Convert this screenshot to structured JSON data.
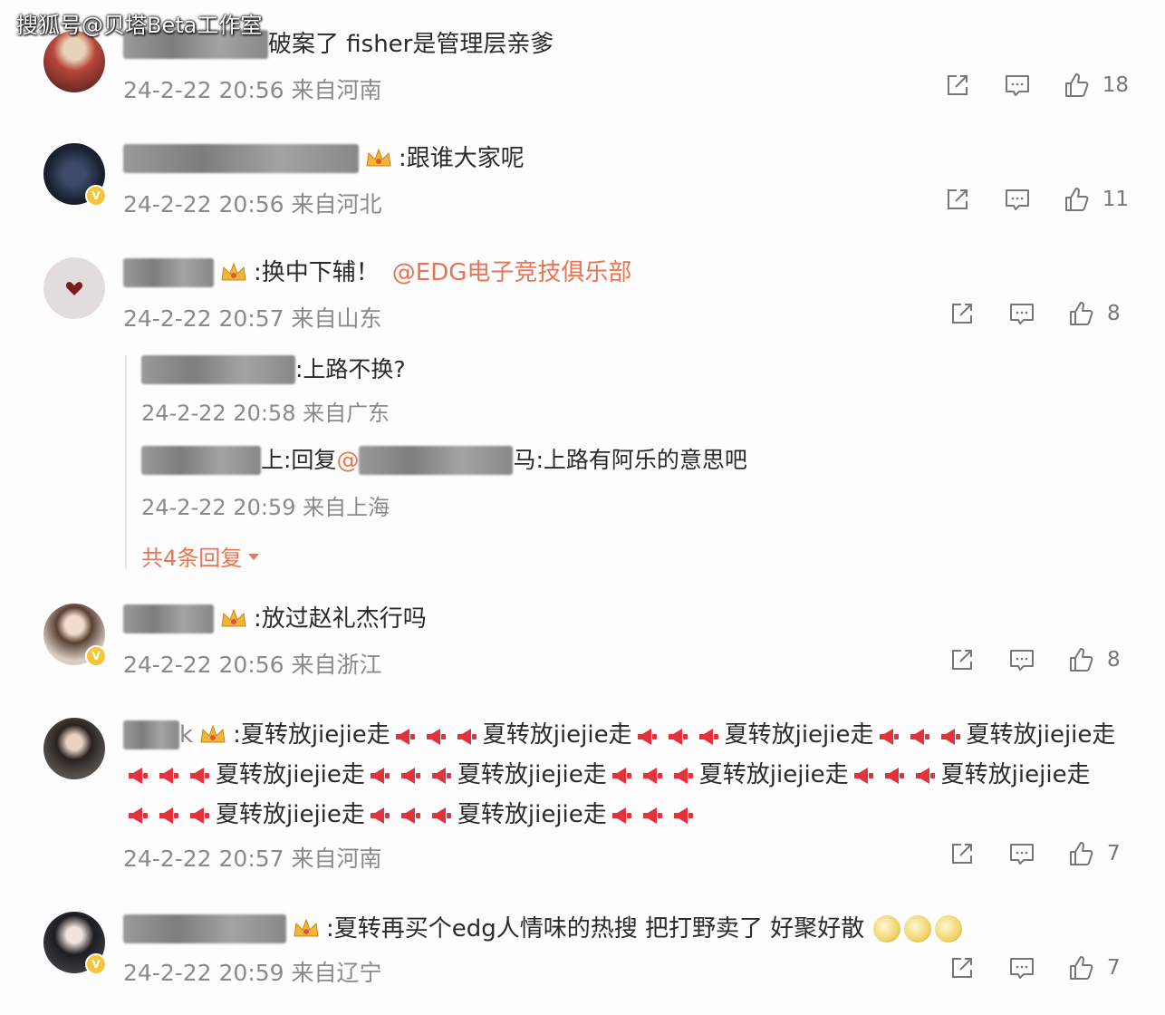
{
  "watermark": "搜狐号@贝塔Beta工作室",
  "colors": {
    "mention": "#eb7350",
    "meta": "#8a8a8a",
    "badge": "#f3c63c"
  },
  "comments": [
    {
      "text": "破案了 fisher是管理层亲爹",
      "time": "24-2-22 20:56",
      "location": "来自河南",
      "likes": "18"
    },
    {
      "text": ":跟谁大家呢",
      "time": "24-2-22 20:56",
      "location": "来自河北",
      "likes": "11"
    },
    {
      "text": ":换中下辅！",
      "mention": "@EDG电子竞技俱乐部",
      "time": "24-2-22 20:57",
      "location": "来自山东",
      "likes": "8",
      "replies": [
        {
          "text": ":上路不换?",
          "time": "24-2-22 20:58",
          "location": "来自广东"
        },
        {
          "prefix": "上:回复",
          "at": "@",
          "suffix": "马:上路有阿乐的意思吧",
          "time": "24-2-22 20:59",
          "location": "来自上海"
        }
      ],
      "more_replies": "共4条回复"
    },
    {
      "text": ":放过赵礼杰行吗",
      "time": "24-2-22 20:56",
      "location": "来自浙江",
      "likes": "8"
    },
    {
      "name_tail": "k",
      "phrase": "夏转放jiejie走",
      "first_prefix": ":",
      "time": "24-2-22 20:57",
      "location": "来自河南",
      "likes": "7"
    },
    {
      "text": ":夏转再买个edg人情味的热搜 把打野卖了 好聚好散",
      "time": "24-2-22 20:59",
      "location": "来自辽宁",
      "likes": "7"
    }
  ],
  "icons": [
    "share-icon",
    "comment-icon",
    "like-icon",
    "crown-badge-icon",
    "megaphone-icon",
    "verified-badge-icon",
    "caret-down-icon",
    "emoji-icon"
  ]
}
